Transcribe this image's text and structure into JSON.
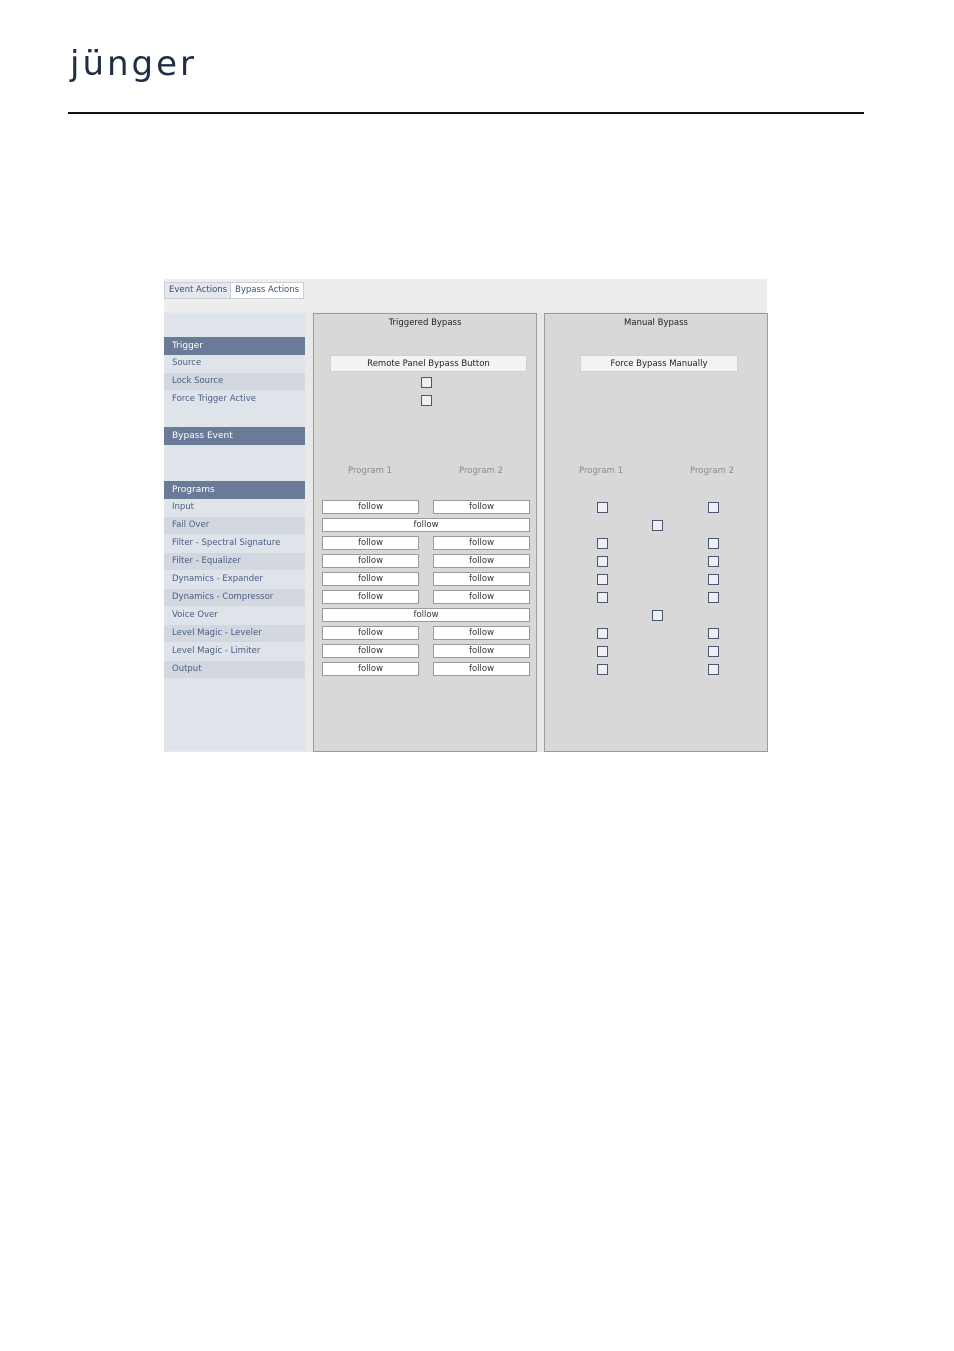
{
  "logo": "jünger",
  "tabs": [
    {
      "label": "Event Actions"
    },
    {
      "label": "Bypass Actions"
    }
  ],
  "sidebar": {
    "trigger_header": "Trigger",
    "trigger_items": [
      {
        "label": "Source"
      },
      {
        "label": "Lock Source"
      },
      {
        "label": "Force Trigger Active"
      }
    ],
    "bypass_event_header": "Bypass Event",
    "programs_header": "Programs",
    "program_items": [
      {
        "label": "Input"
      },
      {
        "label": "Fail Over"
      },
      {
        "label": "Filter - Spectral Signature"
      },
      {
        "label": "Filter - Equalizer"
      },
      {
        "label": "Dynamics - Expander"
      },
      {
        "label": "Dynamics - Compressor"
      },
      {
        "label": "Voice Over"
      },
      {
        "label": "Level Magic - Leveler"
      },
      {
        "label": "Level Magic - Limiter"
      },
      {
        "label": "Output"
      }
    ]
  },
  "triggered": {
    "title": "Triggered Bypass",
    "source_value": "Remote Panel Bypass Button",
    "col1": "Program 1",
    "col2": "Program 2",
    "rows": [
      {
        "p1": "follow",
        "p2": "follow"
      },
      {
        "merged": "follow"
      },
      {
        "p1": "follow",
        "p2": "follow"
      },
      {
        "p1": "follow",
        "p2": "follow"
      },
      {
        "p1": "follow",
        "p2": "follow"
      },
      {
        "p1": "follow",
        "p2": "follow"
      },
      {
        "merged": "follow"
      },
      {
        "p1": "follow",
        "p2": "follow"
      },
      {
        "p1": "follow",
        "p2": "follow"
      },
      {
        "p1": "follow",
        "p2": "follow"
      }
    ]
  },
  "manual": {
    "title": "Manual Bypass",
    "source_value": "Force Bypass Manually",
    "col1": "Program 1",
    "col2": "Program 2"
  }
}
